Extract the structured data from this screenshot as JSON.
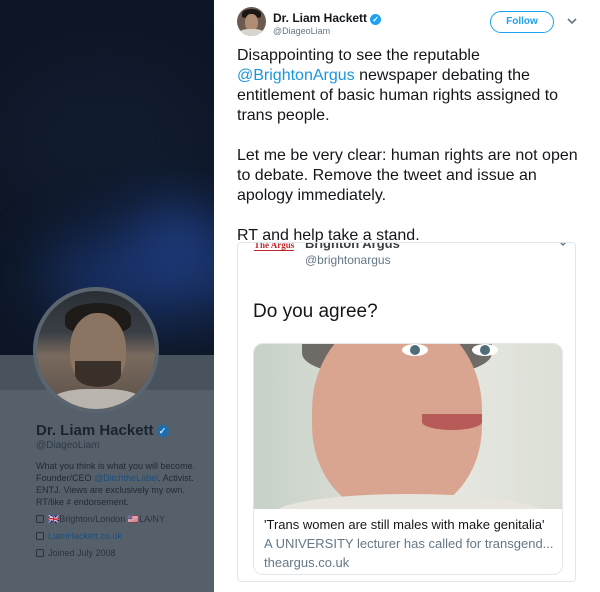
{
  "tweet": {
    "author_name": "Dr. Liam Hackett",
    "author_handle": "@DiageoLiam",
    "follow_label": "Follow",
    "text_p1_before": "Disappointing to see the reputable ",
    "text_p1_mention": "@BrightonArgus",
    "text_p1_after": " newspaper debating the entitlement of basic human rights assigned to trans people.",
    "text_p2": "Let me be very clear: human rights are not open to debate. Remove the tweet and issue an apology immediately.",
    "text_p3": "RT and help take a stand."
  },
  "quoted": {
    "logo_text": "The Argus",
    "source_name": "Brighton Argus",
    "source_handle": "@brightonargus",
    "question": "Do you agree?",
    "link_title": "'Trans women are still males with make genitalia'",
    "link_description": "A UNIVERSITY lecturer has called for transgend...",
    "link_domain": "theargus.co.uk"
  },
  "background_profile": {
    "name": "Dr. Liam Hackett",
    "handle": "@DiageoLiam",
    "bio_1": "What you think is what you will become. Founder/CEO ",
    "bio_link": "@DitchtheLabel",
    "bio_2": ". Activist. ENTJ. Views are exclusively my own. RT/like ≠ endorsement.",
    "location": "🇬🇧Brighton/London 🇺🇸LA/NY",
    "website": "LiamHackett.co.uk",
    "joined": "Joined July 2008"
  },
  "colors": {
    "accent": "#1da1f2",
    "mention": "#1b95e0",
    "argus_red": "#c0272d"
  },
  "icons": [
    "verified-badge-icon",
    "chevron-down-icon",
    "location-icon",
    "link-icon",
    "calendar-icon"
  ]
}
